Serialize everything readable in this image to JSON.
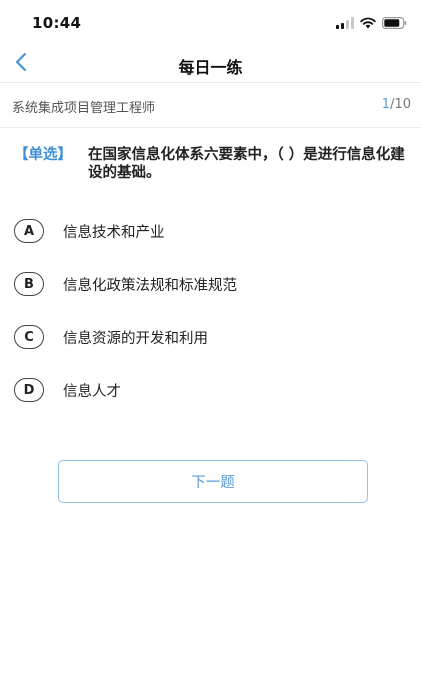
{
  "status_bar": {
    "time": "10:44"
  },
  "nav": {
    "title": "每日一练"
  },
  "subject": {
    "name": "系统集成项目管理工程师",
    "current": "1",
    "total": "/10"
  },
  "question": {
    "type_label": "【单选】",
    "text": "在国家信息化体系六要素中，（ ）是进行信息化建设的基础。"
  },
  "options": [
    {
      "letter": "A",
      "text": "信息技术和产业"
    },
    {
      "letter": "B",
      "text": "信息化政策法规和标准规范"
    },
    {
      "letter": "C",
      "text": "信息资源的开发和利用"
    },
    {
      "letter": "D",
      "text": "信息人才"
    }
  ],
  "next_button": {
    "label": "下一题"
  },
  "colors": {
    "accent": "#3e8fd6",
    "progress": "#5b9bd5",
    "button_border": "#8fc3e8"
  }
}
